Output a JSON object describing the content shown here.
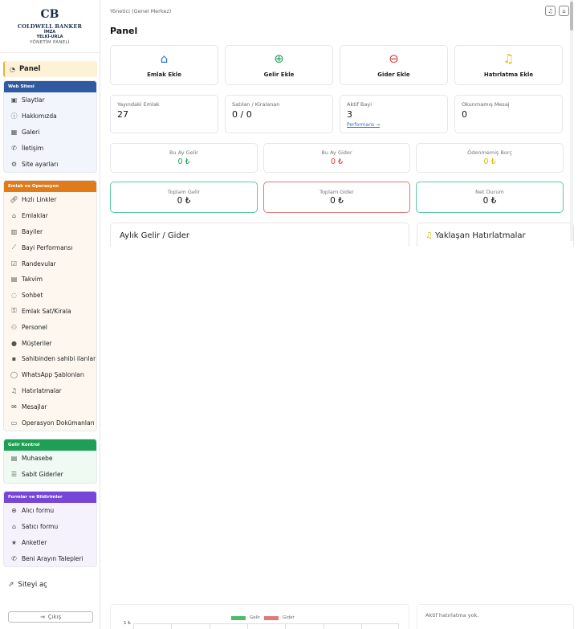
{
  "logo": {
    "mark": "CB",
    "brand": "COLDWELL BANKER",
    "line1": "İMZA",
    "line2": "YELKİ-URLA",
    "panel_name": "YÖNETİM PANELİ"
  },
  "sidebar": {
    "panel_label": "Panel",
    "groups": [
      {
        "title": "Web Sitesi",
        "items": [
          {
            "label": "Slaytlar",
            "icon": "slides-icon"
          },
          {
            "label": "Hakkımızda",
            "icon": "info-icon"
          },
          {
            "label": "Galeri",
            "icon": "gallery-icon"
          },
          {
            "label": "İletişim",
            "icon": "phone-icon"
          },
          {
            "label": "Site ayarları",
            "icon": "gear-icon"
          }
        ]
      },
      {
        "title": "Emlak ve Operasyon",
        "items": [
          {
            "label": "Hızlı Linkler",
            "icon": "link-icon"
          },
          {
            "label": "Emlaklar",
            "icon": "home-icon"
          },
          {
            "label": "Bayiler",
            "icon": "building-icon"
          },
          {
            "label": "Bayi Performansı",
            "icon": "chart-icon"
          },
          {
            "label": "Randevular",
            "icon": "calendar-check-icon"
          },
          {
            "label": "Takvim",
            "icon": "calendar-icon"
          },
          {
            "label": "Sohbet",
            "icon": "chat-icon"
          },
          {
            "label": "Emlak Sat/Kirala",
            "icon": "key-icon"
          },
          {
            "label": "Personel",
            "icon": "people-icon"
          },
          {
            "label": "Müşteriler",
            "icon": "users-icon"
          },
          {
            "label": "Sahibinden sahibi ilanlar",
            "icon": "id-card-icon"
          },
          {
            "label": "WhatsApp Şablonları",
            "icon": "whatsapp-icon"
          },
          {
            "label": "Hatırlatmalar",
            "icon": "bell-icon"
          },
          {
            "label": "Mesajlar",
            "icon": "mail-icon"
          },
          {
            "label": "Operasyon Dokümanları",
            "icon": "folder-icon"
          }
        ]
      },
      {
        "title": "Gelir Kontrol",
        "items": [
          {
            "label": "Muhasebe",
            "icon": "ledger-icon"
          },
          {
            "label": "Sabit Giderler",
            "icon": "list-icon"
          }
        ]
      },
      {
        "title": "Formlar ve Bildirimler",
        "items": [
          {
            "label": "Alıcı formu",
            "icon": "search-home-icon"
          },
          {
            "label": "Satıcı formu",
            "icon": "seller-icon"
          },
          {
            "label": "Anketler",
            "icon": "star-icon"
          },
          {
            "label": "Beni Arayın Talepleri",
            "icon": "phone-call-icon"
          }
        ]
      }
    ],
    "site_open_label": "Siteyi aç",
    "logout_label": "Çıkış"
  },
  "header": {
    "user": "Yönetici (Genel Merkez)",
    "title": "Panel"
  },
  "quick_actions": [
    {
      "label": "Emlak Ekle",
      "icon": "house-plus-icon",
      "color": "#2a6fd6"
    },
    {
      "label": "Gelir Ekle",
      "icon": "plus-circle-icon",
      "color": "#1f9f55"
    },
    {
      "label": "Gider Ekle",
      "icon": "minus-circle-icon",
      "color": "#d63b3b"
    },
    {
      "label": "Hatırlatma Ekle",
      "icon": "bell-icon",
      "color": "#e6b800"
    }
  ],
  "stats": [
    {
      "label": "Yayındaki Emlak",
      "value": "27"
    },
    {
      "label": "Satılan / Kiralanan",
      "value": "0 / 0"
    },
    {
      "label": "Aktif Bayi",
      "value": "3",
      "link": "Performans →"
    },
    {
      "label": "Okunmamış Mesaj",
      "value": "0"
    }
  ],
  "month_finance": [
    {
      "label": "Bu Ay Gelir",
      "value": "0 ₺",
      "color": "#1f9f55"
    },
    {
      "label": "Bu Ay Gider",
      "value": "0 ₺",
      "color": "#d63b3b"
    },
    {
      "label": "Ödenmemiş Borç",
      "value": "0 ₺",
      "color": "#e6b800"
    }
  ],
  "totals": [
    {
      "label": "Toplam Gelir",
      "value": "0 ₺",
      "border": "#58c9a6"
    },
    {
      "label": "Toplam Gider",
      "value": "0 ₺",
      "border": "#e07a7a"
    },
    {
      "label": "Net Durum",
      "value": "0 ₺",
      "border": "#58c9a6"
    }
  ],
  "chart_section": {
    "title": "Aylık Gelir / Gider",
    "legend_income": "Gelir",
    "legend_expense": "Gider",
    "y_tick": "1 ₺",
    "income_color": "#4cbb6a",
    "expense_color": "#e07a7a"
  },
  "reminders_section": {
    "title": "Yaklaşan Hatırlatmalar",
    "empty": "Aktif hatırlatma yok."
  }
}
